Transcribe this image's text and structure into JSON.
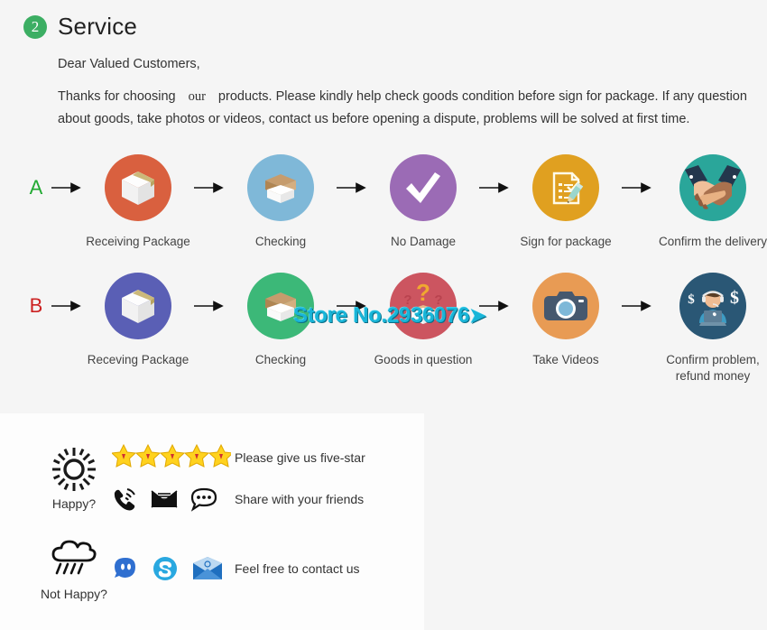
{
  "header": {
    "badge": "2",
    "title": "Service"
  },
  "intro": {
    "greeting": "Dear Valued Customers,",
    "para_part1": "Thanks for choosing",
    "para_our": "our",
    "para_part2": "products. Please kindly help check goods condition before sign for package. If any question about goods, take photos or videos, contact us before opening a dispute, problems will be solved at first time."
  },
  "watermark": {
    "text": "Store No.2936076",
    "color": "#19b5d8"
  },
  "flow": {
    "rows": [
      {
        "letter": "A",
        "letter_color": "#22aa33",
        "steps": [
          {
            "label": "Receiving Package",
            "icon": "closed-box-icon",
            "color": "#d9603f"
          },
          {
            "label": "Checking",
            "icon": "open-box-icon",
            "color": "#7fb8d8"
          },
          {
            "label": "No Damage",
            "icon": "checkmark-icon",
            "color": "#9b6bb5"
          },
          {
            "label": "Sign for package",
            "icon": "clipboard-pencil-icon",
            "color": "#e0a020"
          },
          {
            "label": "Confirm the delivery",
            "icon": "handshake-icon",
            "color": "#2aa69a"
          }
        ]
      },
      {
        "letter": "B",
        "letter_color": "#cc2222",
        "steps": [
          {
            "label": "Receving Package",
            "icon": "closed-box-icon",
            "color": "#5a5fb5"
          },
          {
            "label": "Checking",
            "icon": "open-box-icon",
            "color": "#3cb878"
          },
          {
            "label": "Goods in question",
            "icon": "question-box-icon",
            "color": "#cc5560"
          },
          {
            "label": "Take Videos",
            "icon": "camera-icon",
            "color": "#e89b54"
          },
          {
            "label": "Confirm problem,\nrefund money",
            "icon": "support-agent-icon",
            "color": "#2a5775"
          }
        ]
      }
    ]
  },
  "feedback": {
    "happy": {
      "mood_label": "Happy?",
      "mood_icon": "sun-icon",
      "stars": 5,
      "star_color": "#f5c518",
      "line1_text": "Please give us five-star",
      "line2_text": "Share with your friends",
      "share_icons": [
        "phone-ring-icon",
        "envelope-lines-icon",
        "speech-bubble-icon"
      ]
    },
    "not_happy": {
      "mood_label": "Not Happy?",
      "mood_icon": "rain-cloud-icon",
      "contact_icons": [
        "aliwangwang-icon",
        "skype-icon",
        "email-icon"
      ],
      "contact_text": "Feel free to contact us"
    }
  }
}
